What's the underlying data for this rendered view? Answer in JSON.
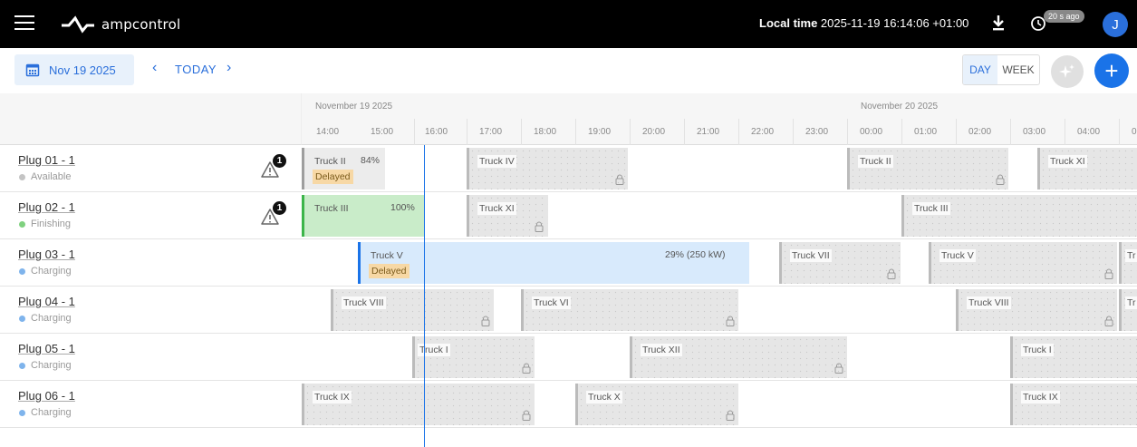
{
  "header": {
    "logo_text": "ampcontrol",
    "local_time_label": "Local time",
    "local_time_value": "2025-11-19 16:14:06 +01:00",
    "refresh_badge": "20 s ago",
    "avatar_initial": "J"
  },
  "toolbar": {
    "date": "Nov 19 2025",
    "today_label": "TODAY",
    "prev": "‹",
    "next": "›",
    "view_day": "DAY",
    "view_week": "WEEK",
    "add": "+"
  },
  "timeline": {
    "date_labels": [
      "November 19 2025",
      "November 20 2025"
    ],
    "hours": [
      "14:00",
      "15:00",
      "16:00",
      "17:00",
      "18:00",
      "19:00",
      "20:00",
      "21:00",
      "22:00",
      "23:00",
      "00:00",
      "01:00",
      "02:00",
      "03:00",
      "04:00",
      "0"
    ]
  },
  "plugs": [
    {
      "name": "Plug 01 - 1",
      "status": "Available",
      "status_color": "#c4c4c4",
      "warnings": "1"
    },
    {
      "name": "Plug 02 - 1",
      "status": "Finishing",
      "status_color": "#7fd17f",
      "warnings": "1"
    },
    {
      "name": "Plug 03 - 1",
      "status": "Charging",
      "status_color": "#7fb4ec",
      "warnings": ""
    },
    {
      "name": "Plug 04 - 1",
      "status": "Charging",
      "status_color": "#7fb4ec",
      "warnings": ""
    },
    {
      "name": "Plug 05 - 1",
      "status": "Charging",
      "status_color": "#7fb4ec",
      "warnings": ""
    },
    {
      "name": "Plug 06 - 1",
      "status": "Charging",
      "status_color": "#7fb4ec",
      "warnings": ""
    }
  ],
  "sessions": {
    "r0": [
      {
        "truck": "Truck II",
        "pct": "84%",
        "delayed": "Delayed"
      },
      {
        "truck": "Truck IV"
      },
      {
        "truck": "Truck II"
      },
      {
        "truck": "Truck XI"
      }
    ],
    "r1": [
      {
        "truck": "Truck III",
        "pct": "100%"
      },
      {
        "truck": "Truck XI"
      },
      {
        "truck": "Truck III"
      }
    ],
    "r2": [
      {
        "truck": "Truck V",
        "pct": "29% (250 kW)",
        "delayed": "Delayed"
      },
      {
        "truck": "Truck VII"
      },
      {
        "truck": "Truck V"
      },
      {
        "truck": "Tr"
      }
    ],
    "r3": [
      {
        "truck": "Truck VIII"
      },
      {
        "truck": "Truck VI"
      },
      {
        "truck": "Truck VIII"
      },
      {
        "truck": "Tr"
      }
    ],
    "r4": [
      {
        "truck": "Truck I"
      },
      {
        "truck": "Truck XII"
      },
      {
        "truck": "Truck I"
      }
    ],
    "r5": [
      {
        "truck": "Truck IX"
      },
      {
        "truck": "Truck X"
      },
      {
        "truck": "Truck IX"
      }
    ]
  },
  "colors": {
    "accent": "#1a73e8",
    "delayed_bg": "#f7d8a5",
    "finishing_bg": "#c9ecc9",
    "charging_bg": "#d8eafc"
  }
}
